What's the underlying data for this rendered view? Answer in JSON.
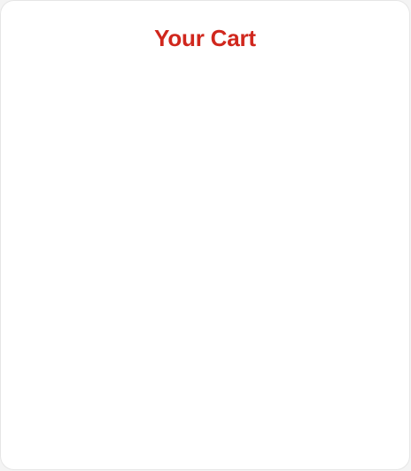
{
  "cart": {
    "title": "Your Cart",
    "title_color": "#d0271d",
    "items": []
  }
}
